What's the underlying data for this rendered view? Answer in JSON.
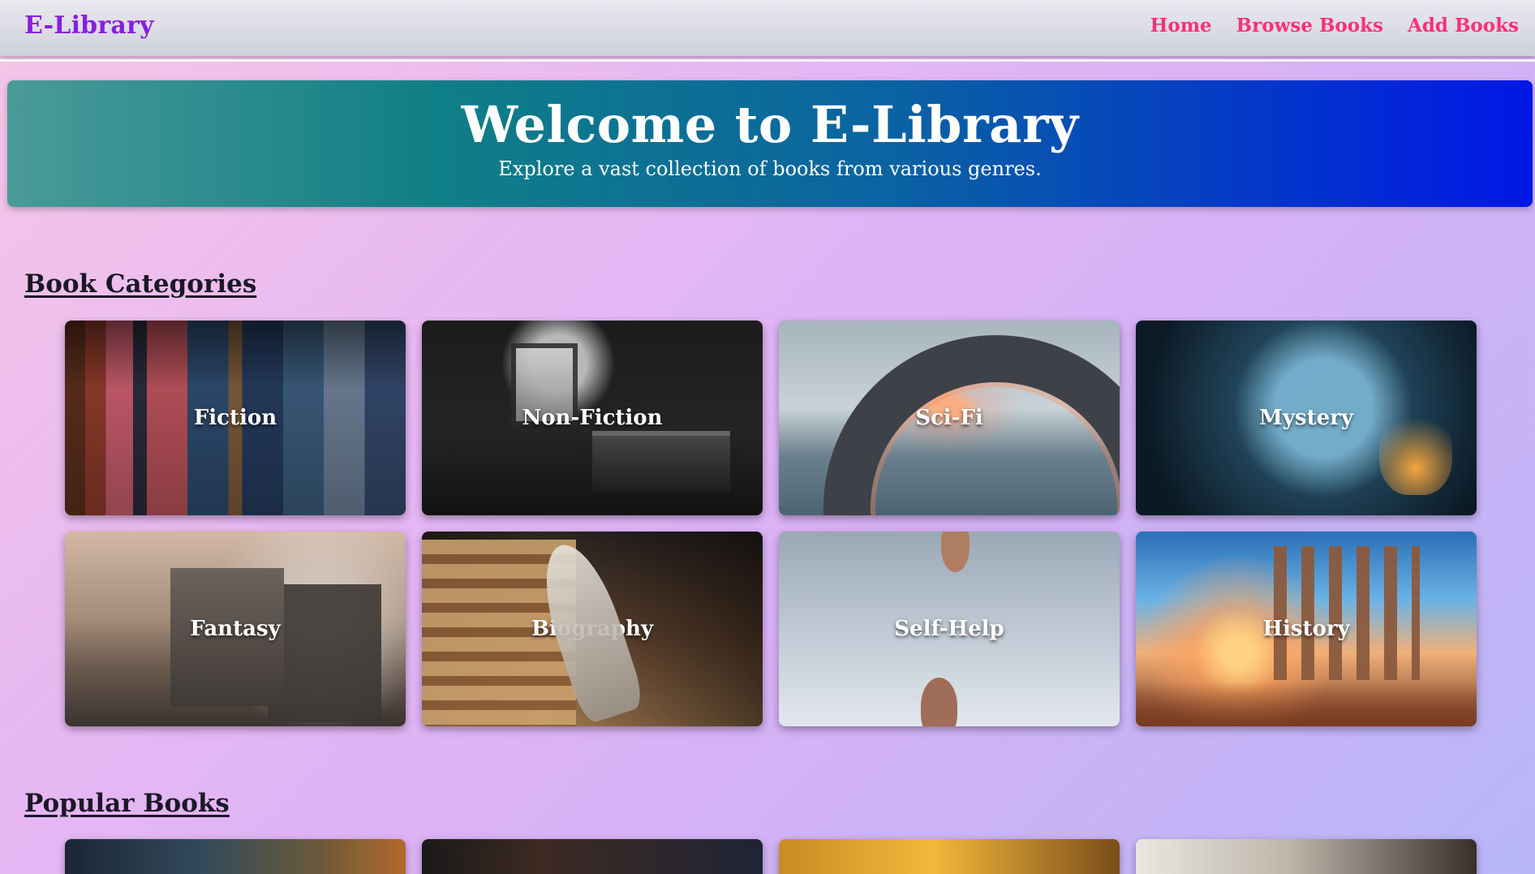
{
  "header": {
    "brand": "E-Library",
    "nav": [
      {
        "label": "Home"
      },
      {
        "label": "Browse Books"
      },
      {
        "label": "Add Books"
      }
    ]
  },
  "hero": {
    "title": "Welcome to E-Library",
    "subtitle": "Explore a vast collection of books from various genres."
  },
  "sections": {
    "categories_title": "Book Categories",
    "popular_title": "Popular Books"
  },
  "categories": [
    {
      "label": "Fiction"
    },
    {
      "label": "Non-Fiction"
    },
    {
      "label": "Sci-Fi"
    },
    {
      "label": "Mystery"
    },
    {
      "label": "Fantasy"
    },
    {
      "label": "Biography"
    },
    {
      "label": "Self-Help"
    },
    {
      "label": "History"
    }
  ],
  "colors": {
    "brand": "#8a1ee0",
    "nav_link": "#ff2f7a",
    "hero_gradient_start": "#4a9a98",
    "hero_gradient_end": "#0017e6"
  }
}
